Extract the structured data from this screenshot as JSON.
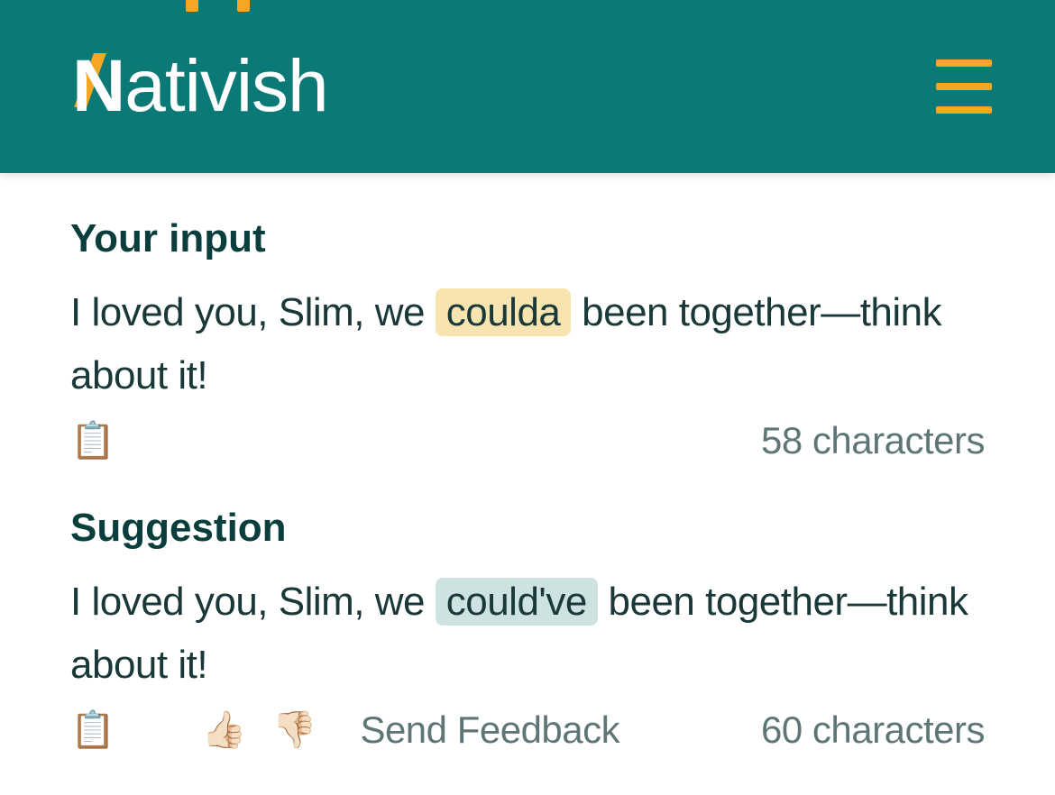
{
  "header": {
    "logo_text": "Nativish"
  },
  "input_section": {
    "title": "Your input",
    "text_before": "I loved you, Slim, we ",
    "highlighted": "coulda",
    "text_after": " been together—think about it!",
    "char_count": "58 characters"
  },
  "suggestion_section": {
    "title": "Suggestion",
    "text_before": "I loved you, Slim, we ",
    "highlighted": "could've",
    "text_after": " been together—think about it!",
    "feedback_link": "Send Feedback",
    "char_count": "60 characters"
  }
}
